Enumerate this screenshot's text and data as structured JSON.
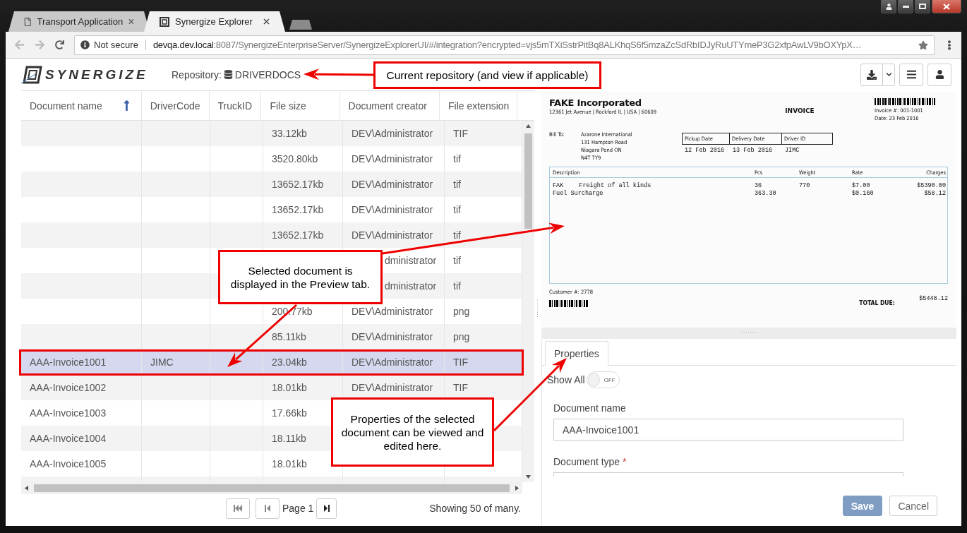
{
  "browser": {
    "tabs": [
      {
        "title": "Transport Application",
        "selected": false
      },
      {
        "title": "Synergize Explorer",
        "selected": true
      }
    ],
    "address": {
      "security": "Not secure",
      "host": "devqa.dev.local",
      "path": ":8087/SynergizeEnterpriseServer/SynergizeExplorerUI/#/integration?encrypted=vjs5mTXiSstrPitBq8ALKhqS6f5mzaZcSdRbIDJyRuUTYmeP3G2xfpAwLV9bOXYpX…"
    }
  },
  "header": {
    "logo_text": "SYNERGIZE",
    "repository_label": "Repository:",
    "repository": "DRIVERDOCS"
  },
  "table": {
    "columns": [
      {
        "label": "Document name",
        "sorted": true
      },
      {
        "label": "DriverCode",
        "sorted": false
      },
      {
        "label": "TruckID",
        "sorted": false
      },
      {
        "label": "File size",
        "sorted": false
      },
      {
        "label": "Document creator",
        "sorted": false
      },
      {
        "label": "File extension",
        "sorted": false
      }
    ],
    "rows": [
      {
        "kind": "plain",
        "selected": false,
        "cells": [
          "",
          "",
          "",
          "33.12kb",
          "DEV\\Administrator",
          "TIF"
        ]
      },
      {
        "kind": "plain",
        "selected": false,
        "cells": [
          "",
          "",
          "",
          "3520.80kb",
          "DEV\\Administrator",
          "tif"
        ]
      },
      {
        "kind": "plain",
        "selected": false,
        "cells": [
          "",
          "",
          "",
          "13652.17kb",
          "DEV\\Administrator",
          "tif"
        ]
      },
      {
        "kind": "plain",
        "selected": false,
        "cells": [
          "",
          "",
          "",
          "13652.17kb",
          "DEV\\Administrator",
          "tif"
        ]
      },
      {
        "kind": "plain",
        "selected": false,
        "cells": [
          "",
          "",
          "",
          "13652.17kb",
          "DEV\\Administrator",
          "tif"
        ]
      },
      {
        "kind": "covered",
        "selected": false,
        "cells": [
          "",
          "",
          "",
          "",
          "dministrator",
          "tif"
        ]
      },
      {
        "kind": "covered",
        "selected": false,
        "cells": [
          "",
          "",
          "",
          "",
          "dministrator",
          "tif"
        ]
      },
      {
        "kind": "plain",
        "selected": false,
        "cells": [
          "",
          "",
          "",
          "200.77kb",
          "DEV\\Administrator",
          "png"
        ]
      },
      {
        "kind": "plain",
        "selected": false,
        "cells": [
          "",
          "",
          "",
          "85.11kb",
          "DEV\\Administrator",
          "png"
        ]
      },
      {
        "kind": "plain",
        "selected": true,
        "cells": [
          "AAA-Invoice1001",
          "JIMC",
          "",
          "23.04kb",
          "DEV\\Administrator",
          "TIF"
        ]
      },
      {
        "kind": "plain",
        "selected": false,
        "cells": [
          "AAA-Invoice1002",
          "",
          "",
          "18.01kb",
          "DEV\\Administrator",
          "TIF"
        ]
      },
      {
        "kind": "plain",
        "selected": false,
        "cells": [
          "AAA-Invoice1003",
          "",
          "",
          "17.66kb",
          "",
          ""
        ]
      },
      {
        "kind": "plain",
        "selected": false,
        "cells": [
          "AAA-Invoice1004",
          "",
          "",
          "18.11kb",
          "",
          ""
        ]
      },
      {
        "kind": "plain",
        "selected": false,
        "cells": [
          "AAA-Invoice1005",
          "",
          "",
          "18.01kb",
          "",
          ""
        ]
      }
    ]
  },
  "pager": {
    "buttons": [
      {
        "kind": "first",
        "disabled": true
      },
      {
        "kind": "previous",
        "disabled": true
      },
      {
        "kind": "next",
        "disabled": false
      }
    ],
    "page": "Page 1",
    "summary": "Showing 50 of many."
  },
  "preview": {
    "company": "FAKE Incorporated",
    "company_address": "12361 Jet Avenue | Rockford IL | USA | 60609",
    "title": "INVOICE",
    "invoice_number": "Invoice #: 001-1001",
    "date": "Date: 23 Feb 2016",
    "bill_to_label": "Bill To:",
    "bill_to": [
      "Azarone International",
      "131 Hampton Road",
      "Niagara Pond ON",
      "N4T 7Y9"
    ],
    "shipment_columns": [
      "Pickup Date",
      "Delivery Date",
      "Driver ID"
    ],
    "shipment_values": [
      "12 Feb 2016",
      "13 Feb 2016",
      "JIMC"
    ],
    "line_columns": [
      "Description",
      "Pcs",
      "Weight",
      "Rate",
      "Charges"
    ],
    "lines": [
      {
        "code": "FAK",
        "description": "Freight of all kinds",
        "pcs": "36",
        "weight": "770",
        "rate": "$7.00",
        "charges": "$5390.00"
      },
      {
        "code": "Fuel Surcharge",
        "pcs": "363.30",
        "rate": "$0.160",
        "charges": "$58.12"
      }
    ],
    "customer": "Customer #: 2778",
    "total_label": "TOTAL DUE:",
    "total": "$5448.12"
  },
  "properties": {
    "tabs": [
      {
        "label": "Properties",
        "selected": true
      }
    ],
    "show_all": {
      "label": "Show All",
      "on": false,
      "state_text": "OFF"
    },
    "fields": [
      {
        "label": "Document name",
        "value": "AAA-Invoice1001"
      },
      {
        "label": "Document type",
        "required": true,
        "required_mark": "*"
      }
    ],
    "buttons": [
      {
        "label": "Save",
        "kind": "primary",
        "disabled": true
      },
      {
        "label": "Cancel",
        "kind": "secondary",
        "disabled": false
      }
    ]
  },
  "annotations": [
    {
      "kind": "callout",
      "text": "Current repository (and view if applicable)"
    },
    {
      "kind": "callout",
      "text": "Selected document is displayed in the Preview tab."
    },
    {
      "kind": "callout",
      "text": "Properties of the selected document can be viewed and edited here."
    }
  ]
}
